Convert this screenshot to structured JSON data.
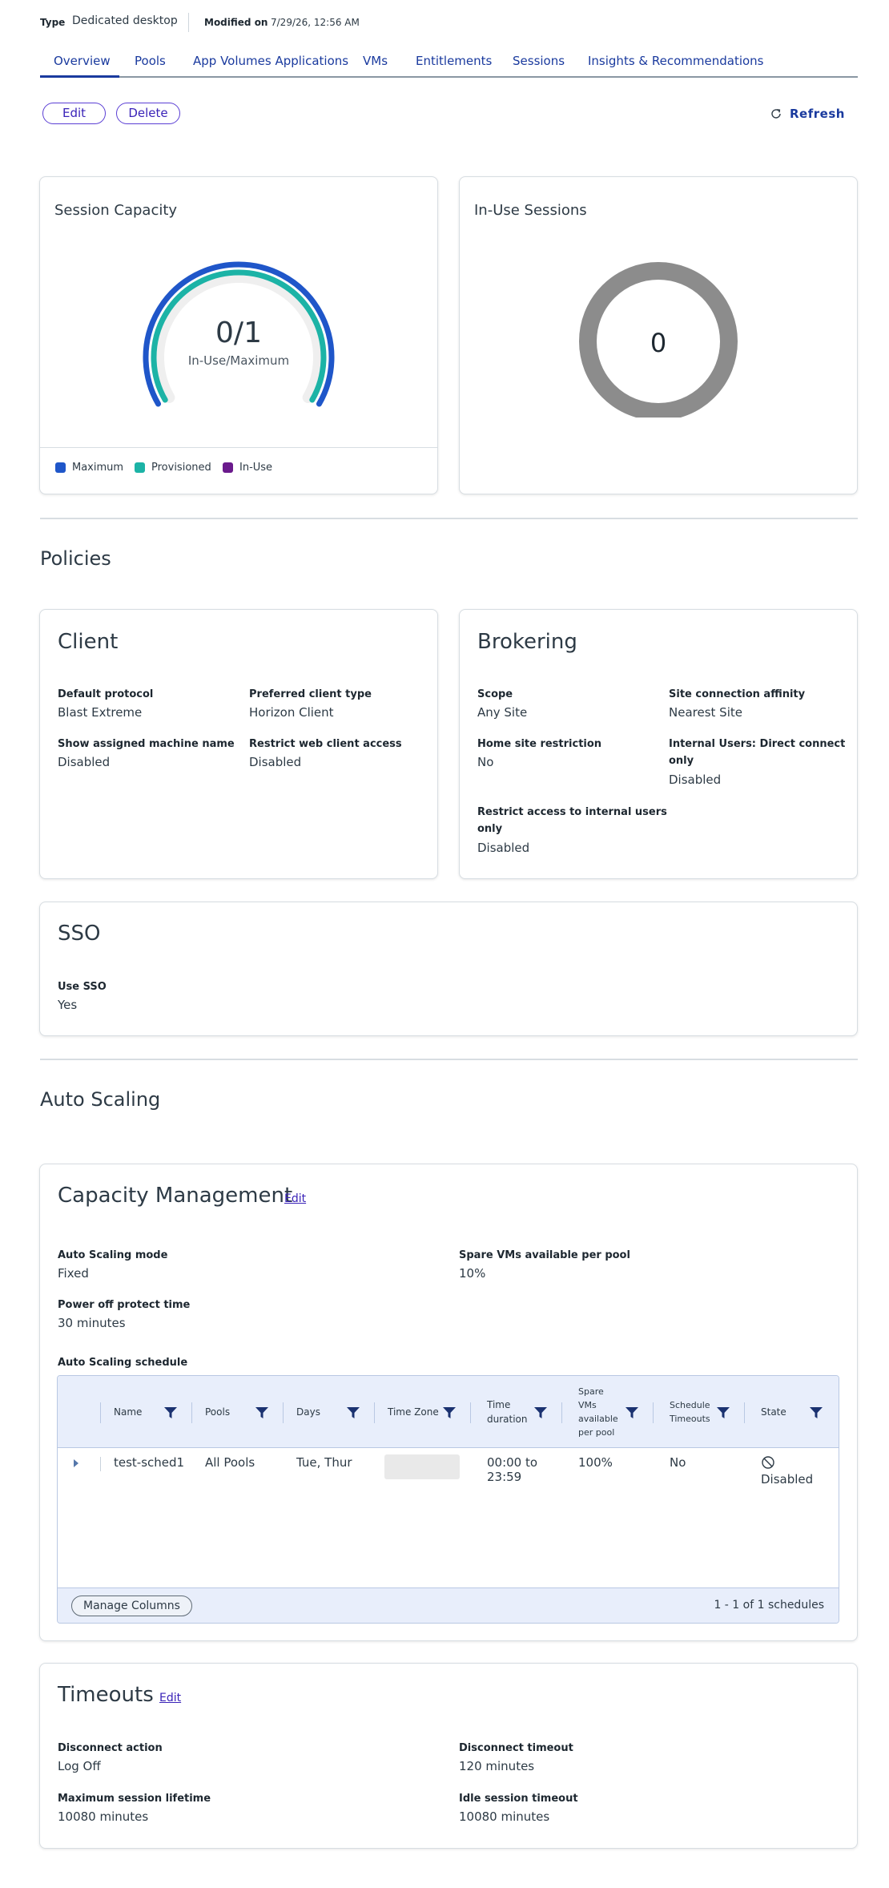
{
  "header": {
    "type_key": "Type",
    "type_value": "Dedicated desktop",
    "modified_key": "Modified on",
    "modified_value": "7/29/26, 12:56 AM"
  },
  "tabs": [
    {
      "label": "Overview",
      "active": true
    },
    {
      "label": "Pools"
    },
    {
      "label": "App Volumes Applications"
    },
    {
      "label": "VMs"
    },
    {
      "label": "Entitlements"
    },
    {
      "label": "Sessions"
    },
    {
      "label": "Insights & Recommendations"
    }
  ],
  "actions": {
    "edit": "Edit",
    "delete": "Delete",
    "refresh": "Refresh"
  },
  "session_capacity": {
    "title": "Session Capacity",
    "value_text": "0/1",
    "caption": "In-Use/Maximum",
    "in_use": 0,
    "maximum": 1,
    "provisioned": 1,
    "legend": [
      {
        "label": "Maximum",
        "color": "#1f56c9"
      },
      {
        "label": "Provisioned",
        "color": "#1cb3a6"
      },
      {
        "label": "In-Use",
        "color": "#6a1a8c"
      }
    ]
  },
  "in_use_sessions": {
    "title": "In-Use Sessions",
    "value": "0",
    "ring_color": "#8c8c8c"
  },
  "policies": {
    "section_title": "Policies",
    "client": {
      "title": "Client",
      "default_protocol_label": "Default protocol",
      "default_protocol_value": "Blast Extreme",
      "preferred_client_label": "Preferred client type",
      "preferred_client_value": "Horizon Client",
      "show_machine_label": "Show assigned machine name",
      "show_machine_value": "Disabled",
      "restrict_web_label": "Restrict web client access",
      "restrict_web_value": "Disabled"
    },
    "brokering": {
      "title": "Brokering",
      "scope_label": "Scope",
      "scope_value": "Any Site",
      "site_affinity_label": "Site connection affinity",
      "site_affinity_value": "Nearest Site",
      "home_site_label": "Home site restriction",
      "home_site_value": "No",
      "internal_direct_label_1": "Internal Users: Direct connect",
      "internal_direct_label_2": "only",
      "internal_direct_value": "Disabled",
      "restrict_internal_label_1": "Restrict access to internal users",
      "restrict_internal_label_2": "only",
      "restrict_internal_value": "Disabled"
    },
    "sso": {
      "title": "SSO",
      "use_sso_label": "Use SSO",
      "use_sso_value": "Yes"
    }
  },
  "auto_scaling": {
    "section_title": "Auto Scaling",
    "capacity": {
      "title": "Capacity Management",
      "edit": "Edit",
      "mode_label": "Auto Scaling mode",
      "mode_value": "Fixed",
      "spare_label": "Spare VMs available per pool",
      "spare_value": "10%",
      "power_label": "Power off protect time",
      "power_value": "30 minutes",
      "schedule_label": "Auto Scaling schedule"
    },
    "table": {
      "headers": {
        "name": "Name",
        "pools": "Pools",
        "days": "Days",
        "timezone": "Time Zone",
        "time_duration_1": "Time",
        "time_duration_2": "duration",
        "spare_1": "Spare",
        "spare_2": "VMs",
        "spare_3": "available",
        "spare_4": "per pool",
        "sched_to_1": "Schedule",
        "sched_to_2": "Timeouts",
        "state": "State"
      },
      "row": {
        "name": "test-sched1",
        "pools": "All Pools",
        "days": "Tue, Thur",
        "time_1": "00:00 to",
        "time_2": "23:59",
        "spare": "100%",
        "sched_timeouts": "No",
        "state": "Disabled"
      },
      "manage_columns": "Manage Columns",
      "pager": "1 - 1 of 1 schedules"
    }
  },
  "timeouts": {
    "title": "Timeouts",
    "edit": "Edit",
    "disconnect_action_label": "Disconnect action",
    "disconnect_action_value": "Log Off",
    "disconnect_timeout_label": "Disconnect timeout",
    "disconnect_timeout_value": "120 minutes",
    "max_lifetime_label": "Maximum session lifetime",
    "max_lifetime_value": "10080 minutes",
    "idle_timeout_label": "Idle session timeout",
    "idle_timeout_value": "10080 minutes"
  }
}
